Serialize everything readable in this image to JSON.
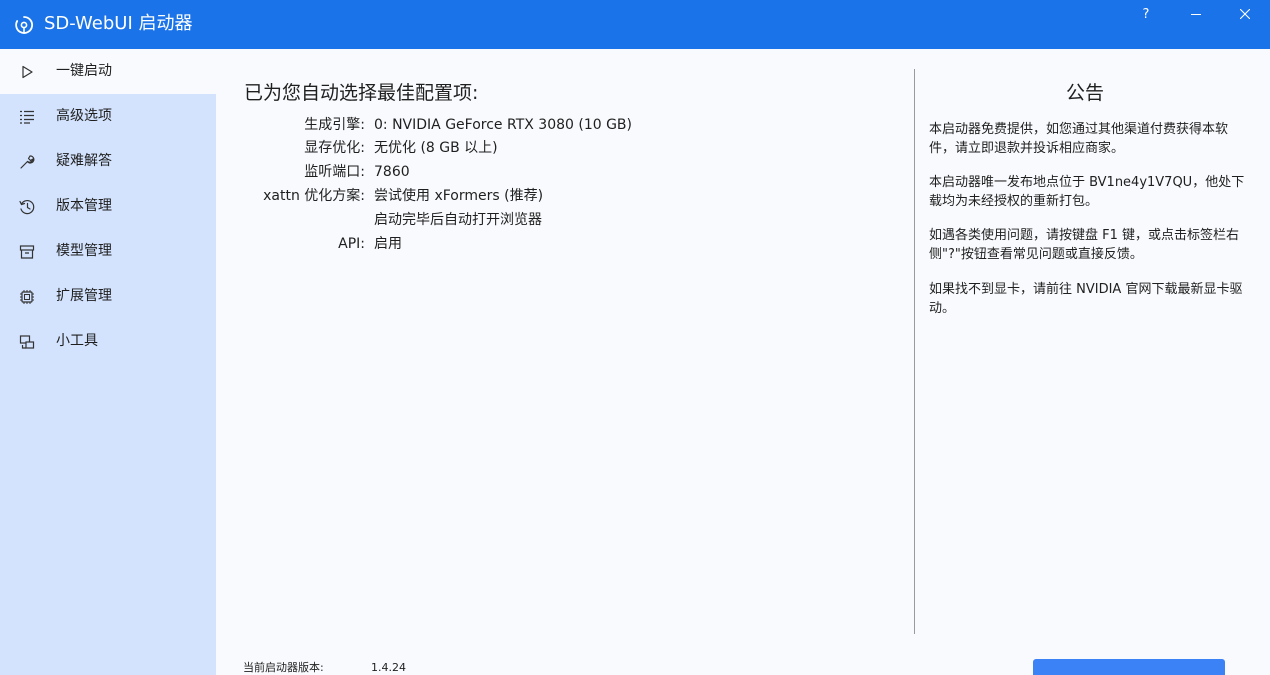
{
  "window": {
    "title": "SD-WebUI 启动器",
    "help_label": "?"
  },
  "sidebar": {
    "items": [
      {
        "label": "一键启动",
        "icon": "play-icon",
        "active": true
      },
      {
        "label": "高级选项",
        "icon": "list-icon",
        "active": false
      },
      {
        "label": "疑难解答",
        "icon": "wrench-icon",
        "active": false
      },
      {
        "label": "版本管理",
        "icon": "history-icon",
        "active": false
      },
      {
        "label": "模型管理",
        "icon": "box-icon",
        "active": false
      },
      {
        "label": "扩展管理",
        "icon": "chip-icon",
        "active": false
      },
      {
        "label": "小工具",
        "icon": "tools-icon",
        "active": false
      }
    ]
  },
  "main": {
    "title": "已为您自动选择最佳配置项:",
    "config": [
      {
        "label": "生成引擎:",
        "value": "0: NVIDIA GeForce RTX 3080 (10 GB)"
      },
      {
        "label": "显存优化:",
        "value": "无优化 (8 GB 以上)"
      },
      {
        "label": "监听端口:",
        "value": "7860"
      },
      {
        "label": "xattn 优化方案:",
        "value": "尝试使用 xFormers (推荐)"
      },
      {
        "label": "",
        "value": "启动完毕后自动打开浏览器"
      },
      {
        "label": "API:",
        "value": "启用"
      }
    ]
  },
  "notice": {
    "title": "公告",
    "paragraphs": [
      "本启动器免费提供，如您通过其他渠道付费获得本软件，请立即退款并投诉相应商家。",
      "本启动器唯一发布地点位于 BV1ne4y1V7QU，他处下载均为未经授权的重新打包。",
      "如遇各类使用问题，请按键盘 F1 键，或点击标签栏右侧\"?\"按钮查看常见问题或直接反馈。",
      "如果找不到显卡，请前往 NVIDIA 官网下载最新显卡驱动。"
    ]
  },
  "footer": {
    "version_label": "当前启动器版本:",
    "version_value": "1.4.24"
  },
  "colors": {
    "titlebar": "#1a73e8",
    "sidebar": "#d3e3fd",
    "content": "#f8fafd",
    "button": "#3b82f6"
  }
}
